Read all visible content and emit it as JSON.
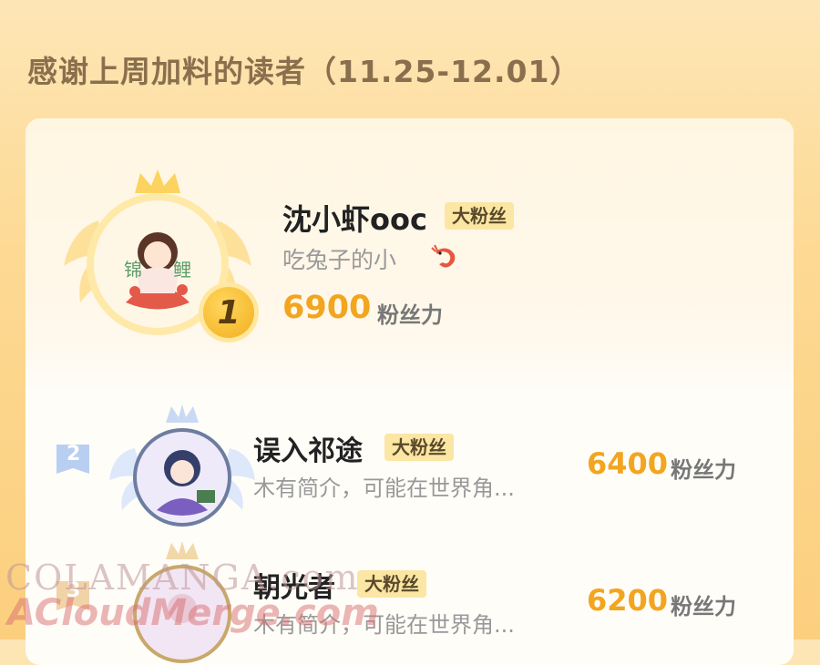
{
  "header": {
    "title": "感谢上周加料的读者（11.25-12.01）"
  },
  "readers": [
    {
      "rank": "1",
      "name": "沈小虾ooc",
      "badge": "大粉丝",
      "bio": "吃兔子的小",
      "score": "6900",
      "unit": "粉丝力"
    },
    {
      "rank": "2",
      "name": "误入祁途",
      "badge": "大粉丝",
      "bio": "木有简介，可能在世界角...",
      "score": "6400",
      "unit": "粉丝力"
    },
    {
      "rank": "3",
      "name": "朝光者",
      "badge": "大粉丝",
      "bio": "木有简介，可能在世界角...",
      "score": "6200",
      "unit": "粉丝力"
    }
  ],
  "avatar1": {
    "text_left": "锦",
    "text_right": "鲤"
  },
  "watermark": {
    "line1": "COLAMANGA.com",
    "line2": "ACloudMerge.com"
  },
  "colors": {
    "accent": "#f2a51f",
    "badge_bg": "#fbe6a4",
    "page_bg": "#fdd993"
  }
}
